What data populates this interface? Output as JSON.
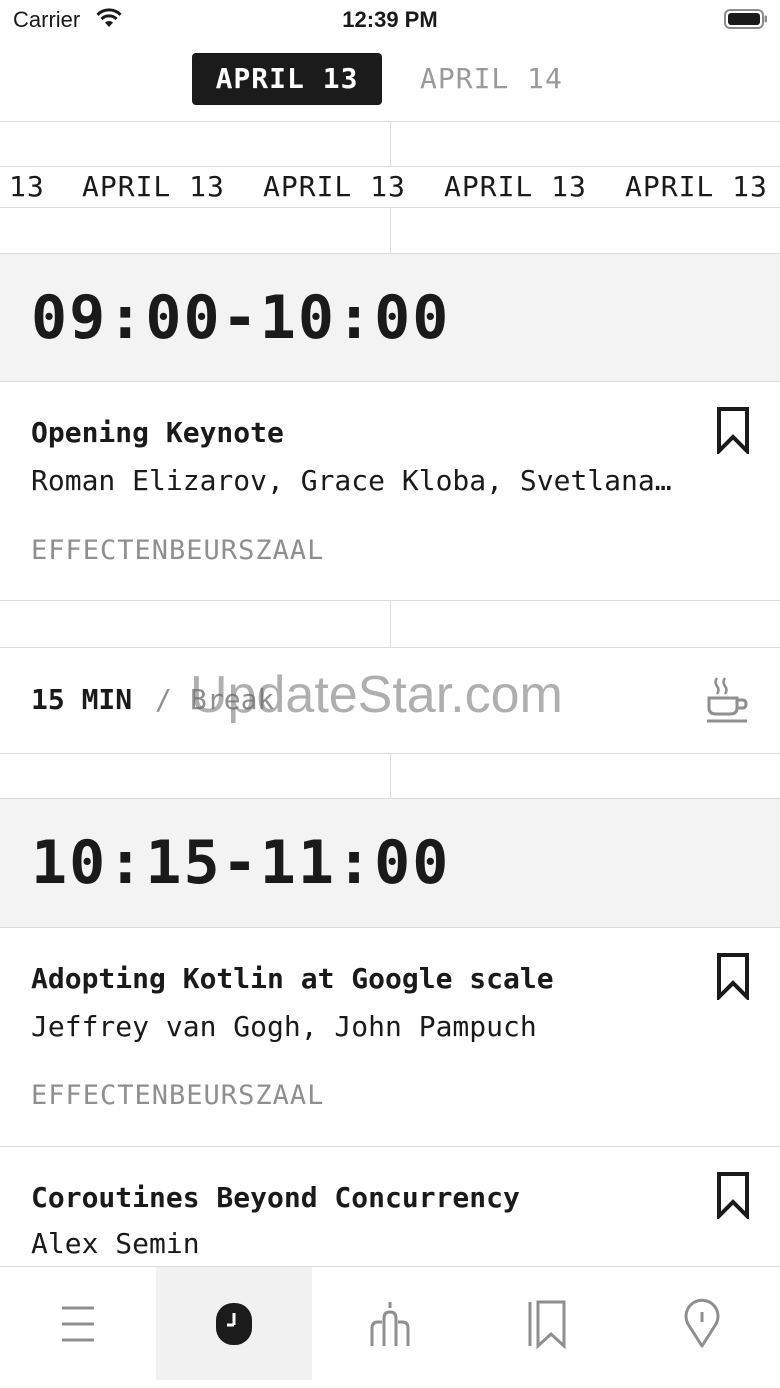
{
  "status_bar": {
    "carrier": "Carrier",
    "time": "12:39 PM"
  },
  "day_tabs": [
    {
      "label": "APRIL 13",
      "active": true
    },
    {
      "label": "APRIL 14",
      "active": false
    }
  ],
  "marquee": {
    "items": [
      "13",
      "APRIL 13",
      "APRIL 13",
      "APRIL 13",
      "APRIL 13"
    ]
  },
  "schedule": {
    "slot1": {
      "time": "09:00-10:00",
      "sessions": [
        {
          "title": "Opening Keynote",
          "speakers": "Roman Elizarov, Grace Kloba, Svetlana…",
          "room": "EFFECTENBEURSZAAL"
        }
      ]
    },
    "break": {
      "duration": "15 MIN",
      "separator": "/",
      "label": "Break"
    },
    "slot2": {
      "time": "10:15-11:00",
      "sessions": [
        {
          "title": "Adopting Kotlin at Google scale",
          "speakers": "Jeffrey van Gogh, John Pampuch",
          "room": "EFFECTENBEURSZAAL"
        },
        {
          "title": "Coroutines Beyond Concurrency",
          "speakers": "Alex Semin"
        }
      ]
    }
  },
  "watermark": "UpdateStar.com",
  "bottom_nav": {
    "items": [
      {
        "icon": "menu-icon",
        "active": false
      },
      {
        "icon": "clock-icon",
        "active": true
      },
      {
        "icon": "speakers-icon",
        "active": false
      },
      {
        "icon": "bookmarks-icon",
        "active": false
      },
      {
        "icon": "location-pin-icon",
        "active": false
      }
    ]
  },
  "colors": {
    "accent": "#1b1b1b",
    "muted": "#8f8f8f",
    "time_block_bg": "#f3f3f3",
    "divider": "#dcdcdc"
  }
}
